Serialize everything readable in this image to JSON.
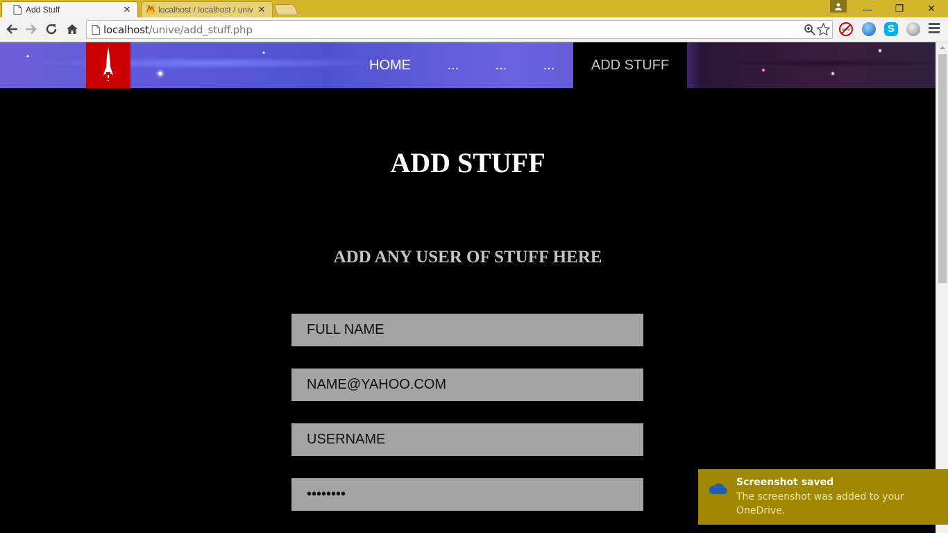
{
  "browser": {
    "tabs": [
      {
        "title": "Add Stuff",
        "close": "✕"
      },
      {
        "title": "localhost / localhost / univ",
        "close": "✕"
      }
    ],
    "address": {
      "host": "localhost",
      "path": "/unive/add_stuff.php"
    },
    "window_buttons": {
      "minimize": "—",
      "restore": "❐",
      "close": "✕"
    }
  },
  "site": {
    "nav": [
      {
        "label": "HOME",
        "active": false
      },
      {
        "label": "...",
        "active": false
      },
      {
        "label": "...",
        "active": false
      },
      {
        "label": "...",
        "active": false
      },
      {
        "label": "ADD STUFF",
        "active": true
      }
    ],
    "title": "ADD STUFF",
    "subtitle": "ADD ANY USER OF STUFF HERE",
    "form": {
      "fullname_placeholder": "FULL NAME",
      "email_placeholder": "NAME@YAHOO.COM",
      "username_placeholder": "USERNAME",
      "password_value": "password"
    },
    "colors": {
      "logo_bg": "#cc0000",
      "field_bg": "#a4a4a4",
      "active_nav_bg": "#000000"
    }
  },
  "notification": {
    "title": "Screenshot saved",
    "body": "The screenshot was added to your OneDrive."
  }
}
